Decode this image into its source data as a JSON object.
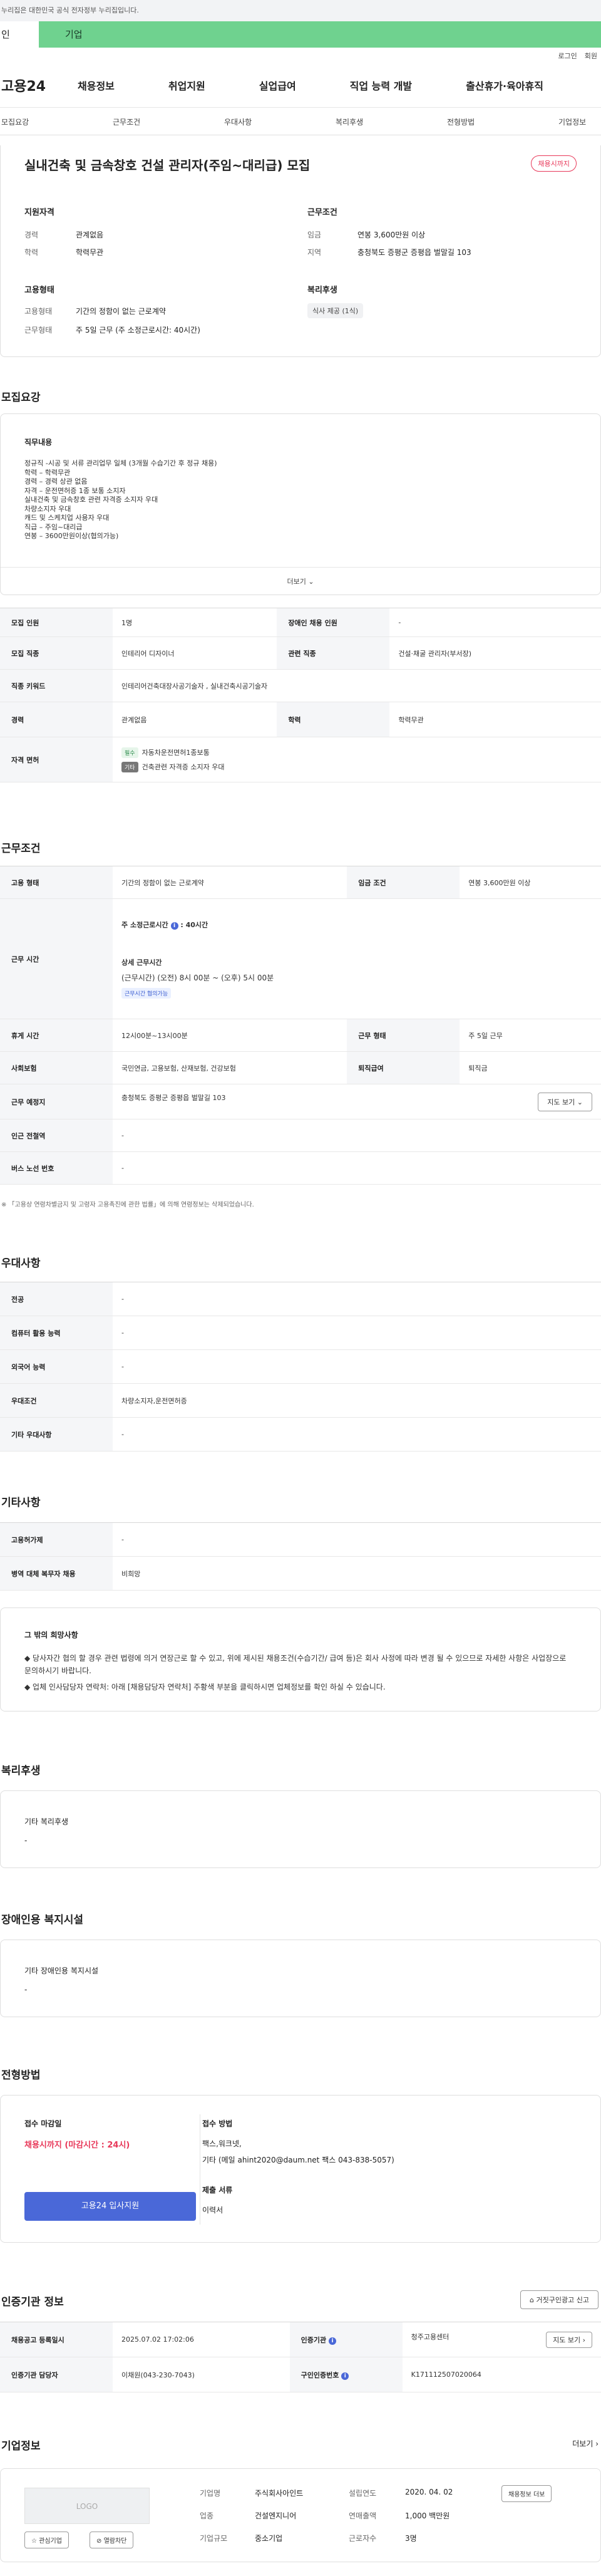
{
  "gov_notice": "누리집은 대한민국 공식 전자정부 누리집입니다.",
  "audience": {
    "individual": "인",
    "business": "기업"
  },
  "util": {
    "login": "로그인",
    "join": "회원"
  },
  "gnb": {
    "logo": "고용24",
    "items": [
      "채용정보",
      "취업지원",
      "실업급여",
      "직업 능력 개발",
      "출산휴가·육아휴직"
    ]
  },
  "tabs": [
    "모집요강",
    "근무조건",
    "우대사항",
    "복리후생",
    "전형방법",
    "기업정보"
  ],
  "job": {
    "title": "실내건축 및 금속창호 건설 관리자(주임~대리급) 모집",
    "status": "채용시까지",
    "qual_label": "지원자격",
    "cond_label": "근무조건",
    "career_k": "경력",
    "career_v": "관계없음",
    "edu_k": "학력",
    "edu_v": "학력무관",
    "wage_k": "임금",
    "wage_v": "연봉 3,600만원 이상",
    "region_k": "지역",
    "region_v": "충청북도 증평군 증평읍 벌말길 103",
    "emp_label": "고용형태",
    "welfare_label": "복리후생",
    "emptype_k": "고용형태",
    "emptype_v": "기간의 정함이 없는 근로계약",
    "worktype_k": "근무형태",
    "worktype_v": "주 5일 근무 (주 소정근로시간: 40시간)",
    "welfare_chip": "식사 제공 (1식)"
  },
  "recruit": {
    "title": "모집요강",
    "desc_label": "직무내용",
    "desc": "정규직 -시공 및 서류 관리업무 일체 (3개월 수습기간 후 정규 채용)\n학력 – 학력무관\n경력 – 경력 상관 없음\n자격 – 운전면허증 1종 보통 소지자\n실내건축 및 금속창호 관련 자격증 소지자 우대\n차량소지자 우대\n캐드 및 스케치업 사용자 우대\n직급 – 주임~대리급\n연봉 – 3600만원이상(협의가능)",
    "more": "더보기",
    "rows": [
      {
        "k1": "모집 인원",
        "v1": "1명",
        "k2": "장애인 채용 인원",
        "v2": "-"
      },
      {
        "k1": "모집 직종",
        "v1": "인테리어 디자이너",
        "k2": "관련 직종",
        "v2": "건설·채굴 관리자(부서장)"
      },
      {
        "k1": "직종 키워드",
        "v1": "인테리어건축대장사공기술자 , 실내건축시공기술자"
      },
      {
        "k1": "경력",
        "v1": "관계없음",
        "k2": "학력",
        "v2": "학력무관"
      }
    ],
    "license_k": "자격 면허",
    "license": [
      {
        "tag": "필수",
        "name": "자동차운전면허1종보통"
      },
      {
        "tag": "기타",
        "name": "건축관련 자격증 소지자 우대"
      }
    ]
  },
  "work": {
    "title": "근무조건",
    "emptype_k": "고용 형태",
    "emptype_v": "기간의 정함이 없는 근로계약",
    "wage_k": "임금 조건",
    "wage_v": "연봉 3,600만원 이상",
    "hours_k": "근무 시간",
    "hours_weekly": "주 소정근로시간",
    "hours_weekly_v": "40시간",
    "hours_detail_label": "상세 근무시간",
    "hours_detail": "(근무시간) (오전) 8시 00분 ~ (오후) 5시 00분",
    "hours_badge": "근무시간 협의가능",
    "rest_k": "휴게 시간",
    "rest_v": "12시00분~13시00분",
    "form_k": "근무 형태",
    "form_v": "주 5일 근무",
    "insurance_k": "사회보험",
    "insurance_v": "국민연금, 고용보험, 산재보험, 건강보험",
    "retire_k": "퇴직급여",
    "retire_v": "퇴직금",
    "place_k": "근무 예정지",
    "place_v": "충청북도 증평군 증평읍 벌말길 103",
    "map_btn": "지도 보기",
    "subway_k": "인근 전철역",
    "subway_v": "-",
    "bus_k": "버스 노선 번호",
    "bus_v": "-",
    "note": "※ 「고용상 연령차별금지 및 고령자 고용촉진에 관한 법률」에 의해 연령정보는 삭제되었습니다."
  },
  "pref": {
    "title": "우대사항",
    "rows": [
      {
        "k": "전공",
        "v": "-"
      },
      {
        "k": "컴퓨터 활용 능력",
        "v": "-"
      },
      {
        "k": "외국어 능력",
        "v": "-"
      },
      {
        "k": "우대조건",
        "v": "차량소지자,운전면허증"
      },
      {
        "k": "기타 우대사항",
        "v": "-"
      }
    ]
  },
  "etc": {
    "title": "기타사항",
    "rows": [
      {
        "k": "고용허가제",
        "v": "-"
      },
      {
        "k": "병역 대체 복무자 채용",
        "v": "비희망"
      }
    ],
    "box_title": "그 밖의 희망사항",
    "lines": [
      "◆ 당사자간 협의 할 경우 관련 법령에 의거 연장근로 할 수 있고, 위에 제시된 채용조건(수습기간/ 급여 등)은 회사 사정에 따라 변경 될 수 있으므로 자세한 사항은 사업장으로 문의하시기 바랍니다.",
      "◆ 업체 인사담당자 연락처: 아래 [채용담당자 연락처] 주황색 부분을 클릭하시면 업체정보를 확인 하실 수 있습니다."
    ]
  },
  "benefit": {
    "title": "복리후생",
    "label": "기타 복리후생",
    "value": "-"
  },
  "disabled": {
    "title": "장애인용 복지시설",
    "label": "기타 장애인용 복지시설",
    "value": "-"
  },
  "selection": {
    "title": "전형방법",
    "deadline_k": "접수 마감일",
    "deadline_v": "채용시까지 (마감시간 : 24시)",
    "apply_btn": "고용24 입사지원",
    "method_k": "접수 방법",
    "method_v1": "팩스,워크넷,",
    "method_v2": "기타 (메일 ahint2020@daum.net 팩스 043-838-5057)",
    "docs_k": "제출 서류",
    "docs_v": "이력서"
  },
  "cert": {
    "title": "인증기관 정보",
    "report_btn": "거짓구인광고 신고",
    "row1": {
      "k1": "채용공고 등록일시",
      "v1": "2025.07.02 17:02:06",
      "k2": "인증기관",
      "v2": "청주고용센터",
      "btn": "지도 보기"
    },
    "row2": {
      "k1": "인증기관 담당자",
      "v1": "이채원(043-230-7043)",
      "k2": "구인인증번호",
      "v2": "K171112507020064"
    }
  },
  "company": {
    "title": "기업정보",
    "more": "더보기",
    "logo": "LOGO",
    "fav_btn": "관심기업",
    "block_btn": "열람차단",
    "jobs_btn": "채용정보 더보",
    "name_k": "기업명",
    "name_v": "주식회사아인트",
    "founded_k": "설립연도",
    "founded_v": "2020. 04. 02",
    "industry_k": "업종",
    "industry_v": "건설엔지니어",
    "sales_k": "연매출액",
    "sales_v": "1,000 백만원",
    "size_k": "기업규모",
    "size_v": "중소기업",
    "emp_k": "근로자수",
    "emp_v": "3명"
  }
}
